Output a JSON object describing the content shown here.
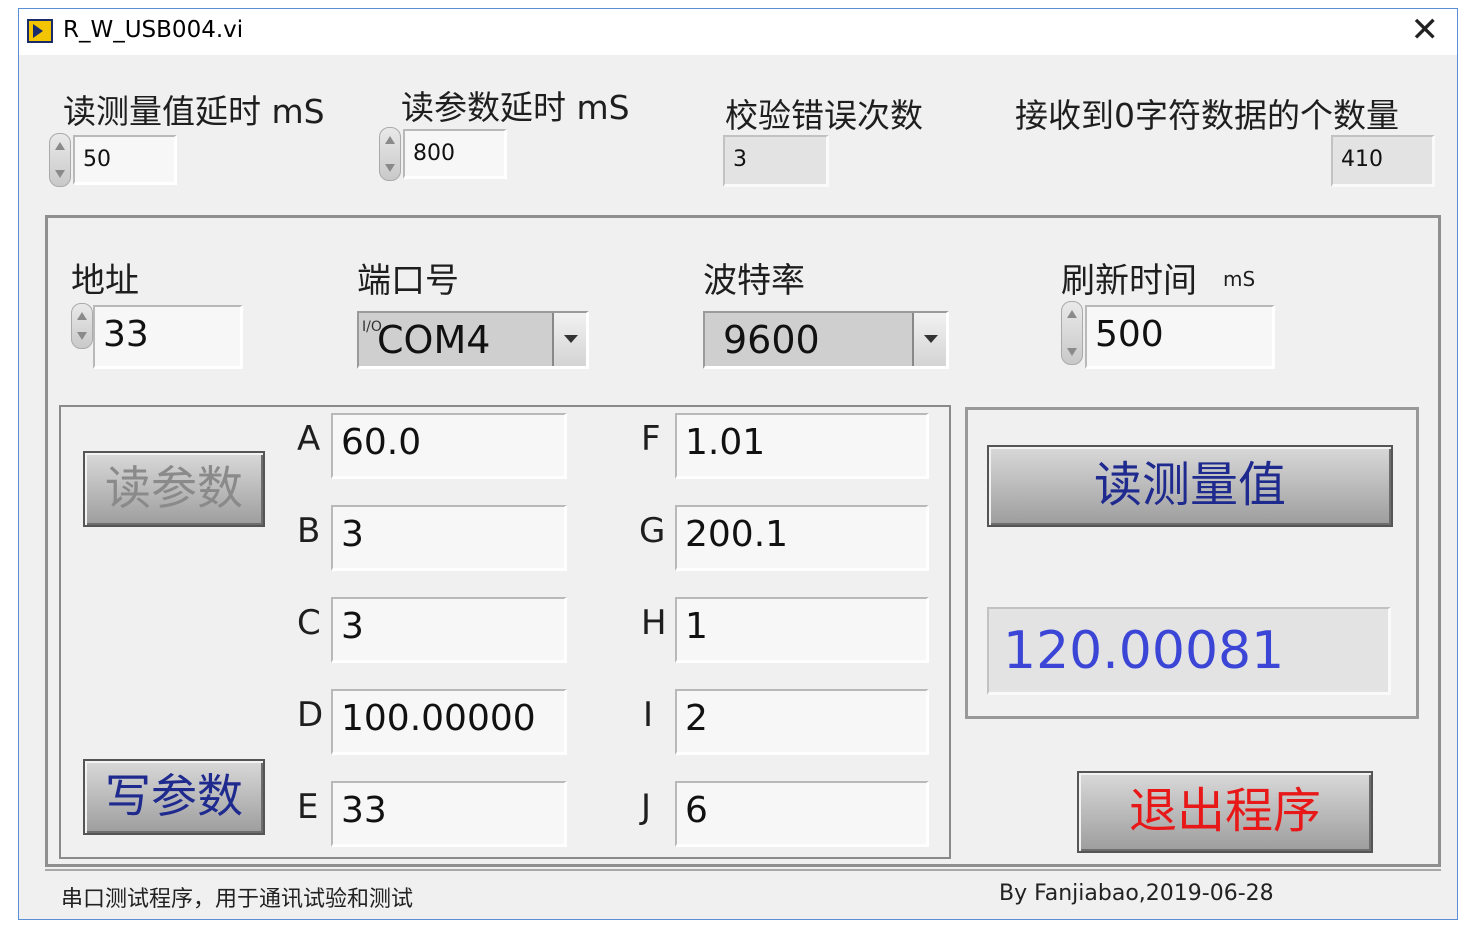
{
  "window": {
    "title": "R_W_USB004.vi",
    "close_glyph": "✕"
  },
  "top_controls": {
    "read_delay": {
      "label": "读测量值延时 mS",
      "value": "50"
    },
    "param_delay": {
      "label": "读参数延时  mS",
      "value": "800"
    },
    "checksum_errors": {
      "label": "校验错误次数",
      "value": "3"
    },
    "zero_char_count": {
      "label": "接收到0字符数据的个数量",
      "value": "410"
    }
  },
  "config": {
    "address": {
      "label": "地址",
      "value": "33"
    },
    "port": {
      "label": "端口号",
      "value": "COM4",
      "icon_glyph": "I/O"
    },
    "baud": {
      "label": "波特率",
      "value": "9600"
    },
    "refresh": {
      "label": "刷新时间",
      "unit": "mS",
      "value": "500"
    }
  },
  "params": {
    "A": {
      "label": "A",
      "value": "60.0"
    },
    "B": {
      "label": "B",
      "value": "3"
    },
    "C": {
      "label": "C",
      "value": "3"
    },
    "D": {
      "label": "D",
      "value": "100.00000"
    },
    "E": {
      "label": "E",
      "value": "33"
    },
    "F": {
      "label": "F",
      "value": "1.01"
    },
    "G": {
      "label": "G",
      "value": "200.1"
    },
    "H": {
      "label": "H",
      "value": "1"
    },
    "I": {
      "label": "I",
      "value": "2"
    },
    "J": {
      "label": "J",
      "value": "6"
    }
  },
  "buttons": {
    "read_params": {
      "label": "读参数",
      "color": "#888888"
    },
    "write_params": {
      "label": "写参数",
      "color": "#1f2a8f"
    },
    "read_measure": {
      "label": "读测量值",
      "color": "#1f2a8f"
    },
    "exit": {
      "label": "退出程序",
      "color": "#e81818"
    }
  },
  "measurement": {
    "value": "120.00081",
    "color": "#3b45d6"
  },
  "status": {
    "left": "串口测试程序，用于通讯试验和测试",
    "right": "By Fanjiabao,2019-06-28"
  }
}
